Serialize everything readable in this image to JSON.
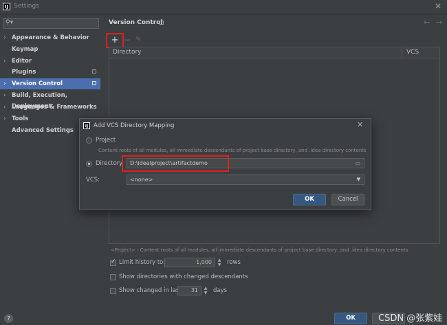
{
  "window": {
    "title": "Settings",
    "logo_text": "IJ"
  },
  "sidebar": {
    "search_placeholder": "",
    "items": [
      {
        "label": "Appearance & Behavior",
        "chevron": "›"
      },
      {
        "label": "Keymap",
        "chevron": ""
      },
      {
        "label": "Editor",
        "chevron": "›"
      },
      {
        "label": "Plugins",
        "chevron": ""
      },
      {
        "label": "Version Control",
        "chevron": "›"
      },
      {
        "label": "Build, Execution, Deployment",
        "chevron": "›"
      },
      {
        "label": "Languages & Frameworks",
        "chevron": "›"
      },
      {
        "label": "Tools",
        "chevron": "›"
      },
      {
        "label": "Advanced Settings",
        "chevron": ""
      }
    ]
  },
  "main": {
    "title": "Version Control",
    "toolbar": {
      "add": "+",
      "remove": "−",
      "edit": "✎"
    },
    "table": {
      "col_directory": "Directory",
      "col_vcs": "VCS"
    },
    "footer_note": "<Project> - Content roots of all modules, all immediate descendants of project base directory, and .idea directory contents",
    "limit_history": {
      "label": "Limit history to:",
      "value": "1,000",
      "unit": "rows",
      "checked": true
    },
    "show_dirs": {
      "label": "Show directories with changed descendants",
      "checked": false
    },
    "show_changed": {
      "label": "Show changed in last",
      "value": "31",
      "unit": "days",
      "checked": false
    }
  },
  "dialog": {
    "logo_text": "IJ",
    "title": "Add VCS Directory Mapping",
    "project_label": "Project",
    "project_hint": "Content roots of all modules, all immediate descendants of project base directory, and .idea directory contents",
    "directory_label": "Directory",
    "directory_value": "D:\\idealproject\\artifactdemo",
    "vcs_label": "VCS:",
    "vcs_value": "<none>",
    "ok": "OK",
    "cancel": "Cancel"
  },
  "bottom": {
    "help": "?",
    "ok": "OK",
    "watermark": "CSDN @张紫娃"
  },
  "colors": {
    "selection": "#4b6eaf",
    "highlight_box": "#e02020",
    "primary_button": "#365880"
  },
  "icons": {
    "close": "close-icon",
    "search": "search-icon",
    "folder": "folder-icon",
    "dropdown": "chevron-down-icon"
  }
}
